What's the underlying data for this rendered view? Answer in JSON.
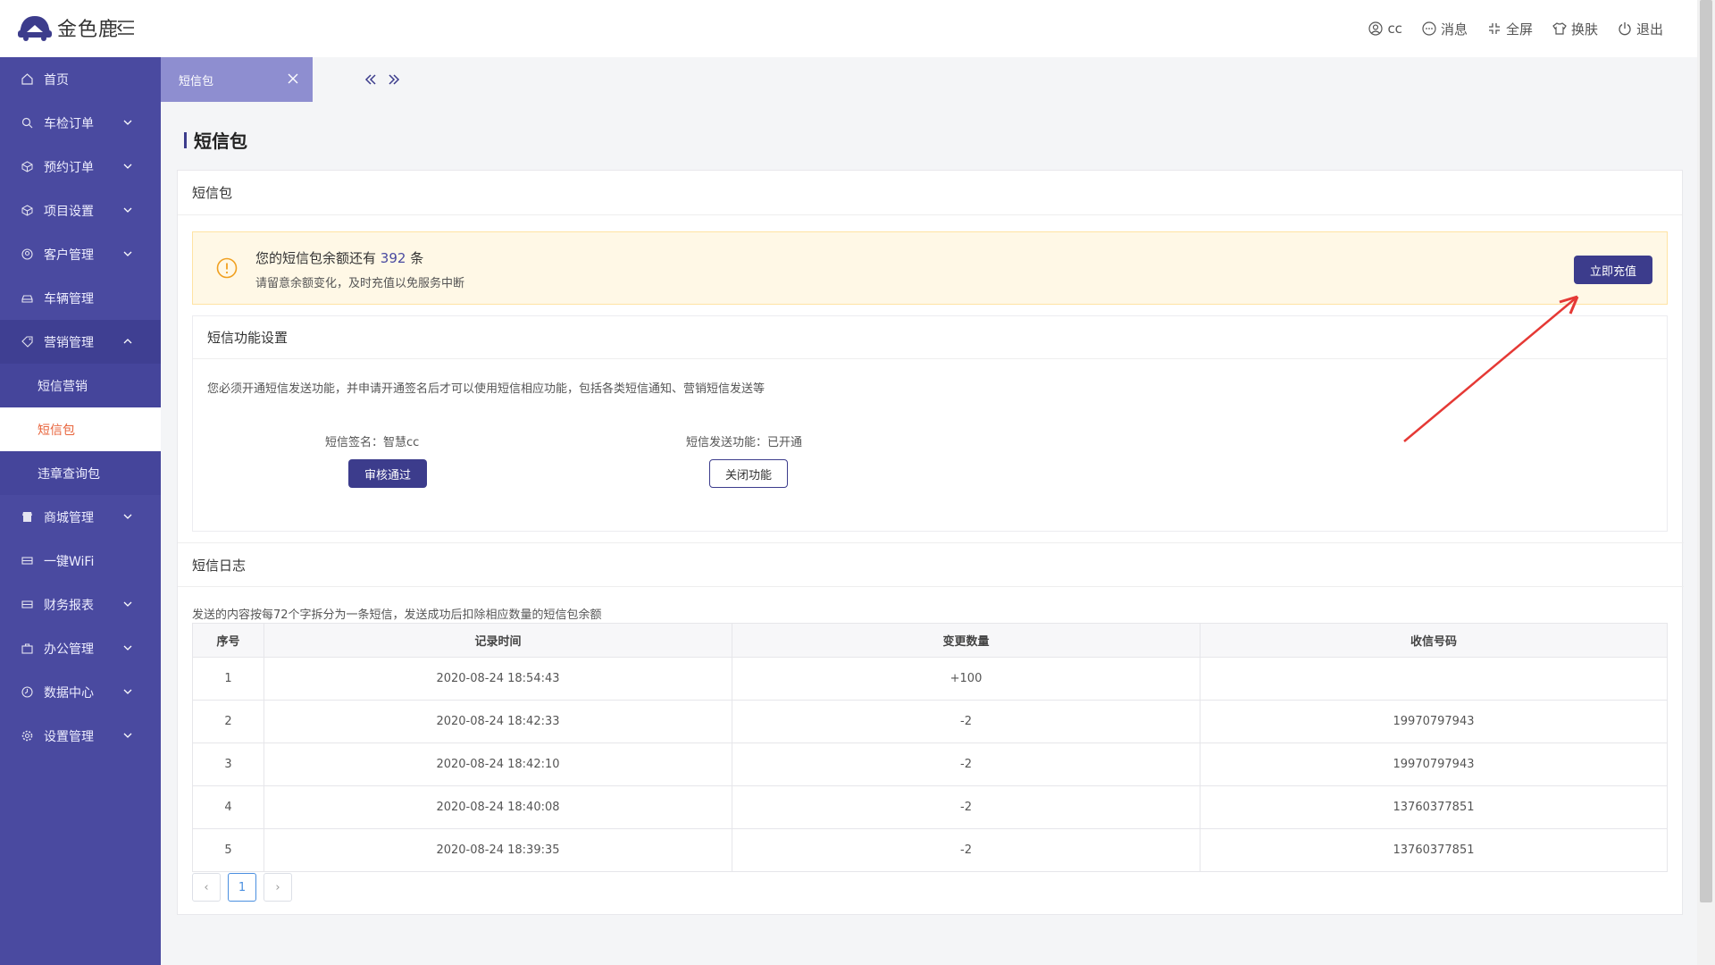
{
  "app": {
    "brand": "金色鹿"
  },
  "header": {
    "user": "cc",
    "messages": "消息",
    "fullscreen": "全屏",
    "skin": "换肤",
    "logout": "退出"
  },
  "sidebar": {
    "items": [
      {
        "label": "首页"
      },
      {
        "label": "车检订单"
      },
      {
        "label": "预约订单"
      },
      {
        "label": "项目设置"
      },
      {
        "label": "客户管理"
      },
      {
        "label": "车辆管理"
      },
      {
        "label": "营销管理"
      },
      {
        "label": "短信营销"
      },
      {
        "label": "短信包"
      },
      {
        "label": "违章查询包"
      },
      {
        "label": "商城管理"
      },
      {
        "label": "一键WiFi"
      },
      {
        "label": "财务报表"
      },
      {
        "label": "办公管理"
      },
      {
        "label": "数据中心"
      },
      {
        "label": "设置管理"
      }
    ]
  },
  "tabs": {
    "active": "短信包"
  },
  "page": {
    "title": "短信包"
  },
  "card": {
    "title": "短信包",
    "alert": {
      "prefix": "您的短信包余额还有",
      "count": "392",
      "suffix": "条",
      "hint": "请留意余额变化，及时充值以免服务中断",
      "button": "立即充值"
    },
    "settings": {
      "title": "短信功能设置",
      "desc": "您必须开通短信发送功能，并申请开通签名后才可以使用短信相应功能，包括各类短信通知、营销短信发送等",
      "signature_label": "短信签名：智慧cc",
      "signature_button": "审核通过",
      "function_label": "短信发送功能：已开通",
      "function_button": "关闭功能"
    },
    "log": {
      "title": "短信日志",
      "desc": "发送的内容按每72个字拆分为一条短信，发送成功后扣除相应数量的短信包余额",
      "columns": [
        "序号",
        "记录时间",
        "变更数量",
        "收信号码"
      ],
      "rows": [
        {
          "no": "1",
          "time": "2020-08-24 18:54:43",
          "change": "+100",
          "phone": ""
        },
        {
          "no": "2",
          "time": "2020-08-24 18:42:33",
          "change": "-2",
          "phone": "19970797943"
        },
        {
          "no": "3",
          "time": "2020-08-24 18:42:10",
          "change": "-2",
          "phone": "19970797943"
        },
        {
          "no": "4",
          "time": "2020-08-24 18:40:08",
          "change": "-2",
          "phone": "13760377851"
        },
        {
          "no": "5",
          "time": "2020-08-24 18:39:35",
          "change": "-2",
          "phone": "13760377851"
        }
      ]
    },
    "pager": {
      "prev": "‹",
      "current": "1",
      "next": "›"
    }
  }
}
